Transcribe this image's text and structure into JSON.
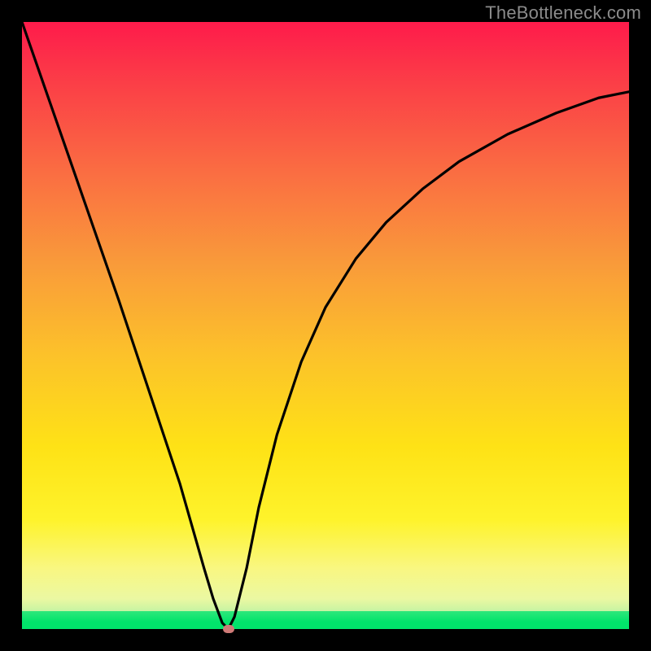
{
  "watermark": "TheBottleneck.com",
  "colors": {
    "frame_bg": "#000000",
    "grad_top": "#fe1b4b",
    "grad_mid_upper": "#f9833e",
    "grad_mid": "#fedb1c",
    "grad_lower": "#f7f695",
    "grad_bottom_hint": "#c3f59a",
    "green_solid": "#01e46b",
    "curve": "#000000",
    "marker": "#cf7a77"
  },
  "chart_data": {
    "type": "line",
    "title": "",
    "xlabel": "",
    "ylabel": "",
    "xlim": [
      0,
      100
    ],
    "ylim": [
      0,
      100
    ],
    "x": [
      0,
      4,
      8,
      12,
      16,
      20,
      24,
      26,
      28,
      30,
      31.5,
      33,
      34,
      35,
      37,
      39,
      42,
      46,
      50,
      55,
      60,
      66,
      72,
      80,
      88,
      95,
      100
    ],
    "y": [
      100,
      88.5,
      77,
      65.5,
      54,
      42,
      30,
      24,
      17,
      10,
      5,
      1,
      0,
      2,
      10,
      20,
      32,
      44,
      53,
      61,
      67,
      72.5,
      77,
      81.5,
      85,
      87.5,
      88.5
    ],
    "marker": {
      "x": 34,
      "y": 0
    },
    "notes": "V-shaped bottleneck curve; minimum occurs near x≈34 at y≈0. Left branch is nearly linear from (0,100); right branch is convex rising toward (100,~89). No axis ticks or numeric labels shown in source image — values are estimates from curve geometry on a normalized 0–100 range."
  }
}
